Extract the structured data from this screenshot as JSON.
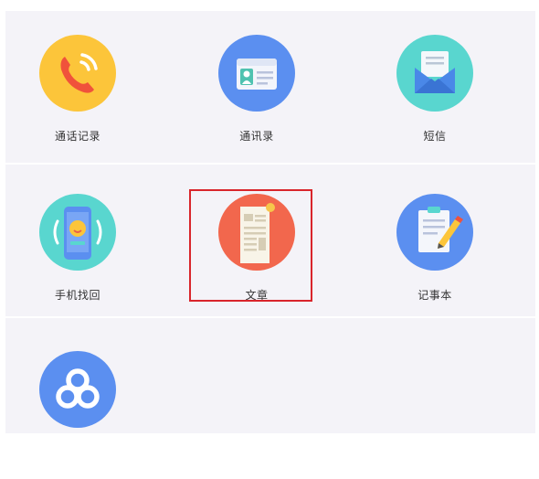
{
  "apps": [
    {
      "label": "通话记录",
      "icon": "phone-icon",
      "bg": "#fcc53a"
    },
    {
      "label": "通讯录",
      "icon": "contact-card-icon",
      "bg": "#5b8ff0"
    },
    {
      "label": "短信",
      "icon": "envelope-icon",
      "bg": "#59d6cf"
    },
    {
      "label": "手机找回",
      "icon": "phone-locate-icon",
      "bg": "#59d6cf"
    },
    {
      "label": "文章",
      "icon": "document-icon",
      "bg": "#f2674d",
      "selected": true
    },
    {
      "label": "记事本",
      "icon": "notepad-pencil-icon",
      "bg": "#5b8ff0"
    },
    {
      "label": "",
      "icon": "cloud-icon",
      "bg": "#5b8ff0"
    }
  ],
  "colors": {
    "selection_border": "#d9252b",
    "background": "#f4f3f8"
  }
}
